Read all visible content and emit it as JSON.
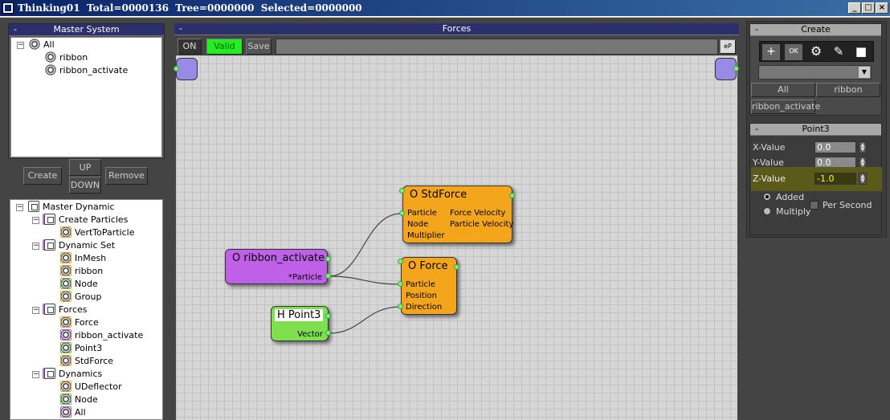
{
  "window": {
    "title": "Thinking01  Total=0000136  Tree=0000000  Selected=0000000"
  },
  "master_system": {
    "title": "Master System",
    "collapse": "-",
    "items": [
      "All",
      "ribbon",
      "ribbon_activate"
    ]
  },
  "buttons": {
    "create": "Create",
    "up": "UP",
    "down": "DOWN",
    "remove": "Remove"
  },
  "master_dynamic": {
    "items": [
      "Master Dynamic",
      "Create Particles",
      "VertToParticle",
      "Dynamic Set",
      "InMesh",
      "ribbon",
      "Node",
      "Group",
      "Forces",
      "Force",
      "ribbon_activate",
      "Point3",
      "StdForce",
      "Dynamics",
      "UDeflector",
      "Node",
      "All"
    ]
  },
  "forces_panel": {
    "title": "Forces",
    "collapse": "-",
    "on": "ON",
    "valid": "Valid",
    "save": "Save",
    "corner_icon": "eP"
  },
  "nodes": {
    "stdforce": {
      "title": "O StdForce",
      "ports_in": [
        "Particle",
        "Node",
        "Multiplier"
      ],
      "ports_out": [
        "Force Velocity",
        "Particle Velocity"
      ]
    },
    "force": {
      "title": "O Force",
      "ports_in": [
        "Particle",
        "Position",
        "Direction"
      ]
    },
    "ribbon_activate": {
      "title": "O ribbon_activate",
      "port_out": "*Particle"
    },
    "point3": {
      "title": "H Point3",
      "port_out": "Vector"
    }
  },
  "create_panel": {
    "title": "Create",
    "collapse": "-",
    "tools": [
      "add-operator-icon",
      "add-ok-icon",
      "gear-icon",
      "wrench-icon",
      "cube-icon"
    ],
    "dropdown_value": "",
    "tabs": [
      "All",
      "ribbon",
      "ribbon_activate"
    ]
  },
  "point3_panel": {
    "title": "Point3",
    "collapse": "-",
    "x_label": "X-Value",
    "x_value": "0.0",
    "y_label": "Y-Value",
    "y_value": "0.0",
    "z_label": "Z-Value",
    "z_value": "-1.0",
    "added": "Added",
    "multiply": "Multiply",
    "per_second": "Per Second"
  },
  "colors": {
    "node_orange": "#f3a51c",
    "node_purple": "#c060e8",
    "node_green": "#7fdf4f",
    "valid_green": "#22ee22",
    "highlight": "#5a5a1a"
  }
}
